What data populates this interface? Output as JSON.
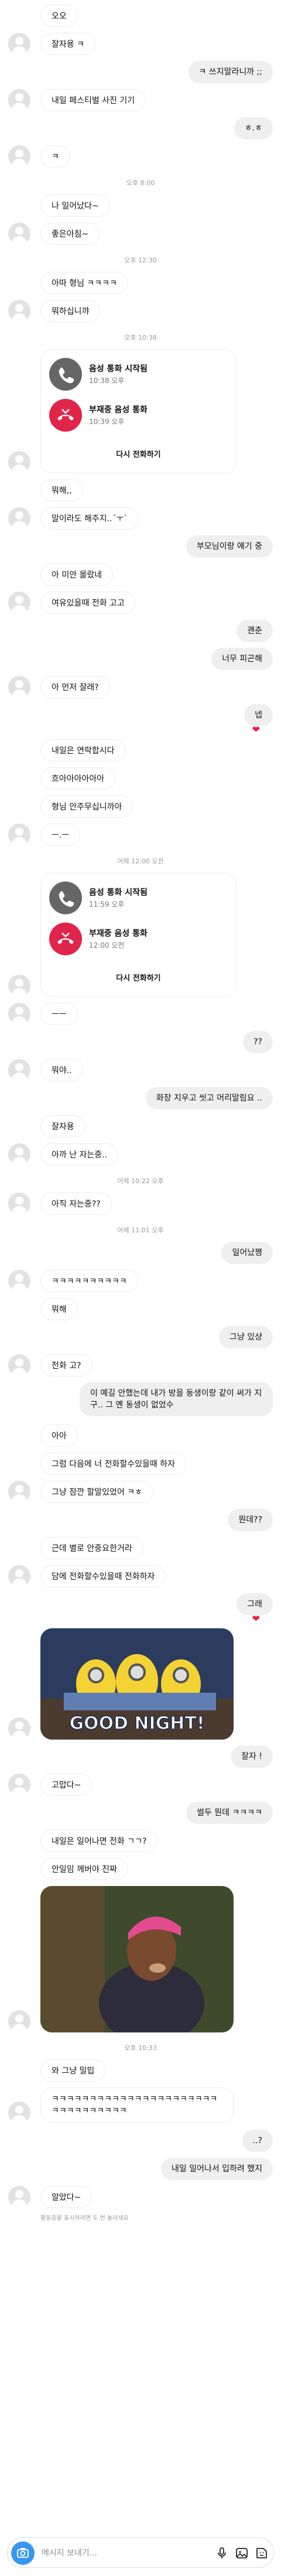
{
  "messages": [
    {
      "kind": "in",
      "text": "오오",
      "avatar": false
    },
    {
      "kind": "in",
      "text": "잘자용 ㅋ",
      "avatar": true
    },
    {
      "kind": "out",
      "text": "ㅋ 쓰지말라니까 ;;"
    },
    {
      "kind": "in",
      "text": "내일 페스티벌 사진 기기",
      "avatar": true
    },
    {
      "kind": "out",
      "text": "ㅎ.ㅎ"
    },
    {
      "kind": "in",
      "text": "ㅋ",
      "avatar": true
    },
    {
      "kind": "time",
      "text": "오후 8:00"
    },
    {
      "kind": "in",
      "text": "나 일어났다~",
      "avatar": false
    },
    {
      "kind": "in",
      "text": "좋은아침~",
      "avatar": true
    },
    {
      "kind": "time",
      "text": "오후 12:30"
    },
    {
      "kind": "in",
      "text": "아따 형님 ㅋㅋㅋㅋ",
      "avatar": false
    },
    {
      "kind": "in",
      "text": "뭐하십니꺄",
      "avatar": true
    },
    {
      "kind": "time",
      "text": "오후 10:38"
    }
  ],
  "call1": {
    "answered_title": "음성 통화 시작됨",
    "answered_time": "10:38 오후",
    "missed_title": "부재중 음성 통화",
    "missed_time": "10:39 오후",
    "callback": "다시 전화하기"
  },
  "messages2": [
    {
      "kind": "in",
      "text": "뭐해,,",
      "avatar": false
    },
    {
      "kind": "in",
      "text": "말이라도 해주지..´ㅜ`",
      "avatar": true
    },
    {
      "kind": "out",
      "text": "부모님이랑 얘기 중"
    },
    {
      "kind": "in",
      "text": "아 미안 몰랐네",
      "avatar": false
    },
    {
      "kind": "in",
      "text": "여유있을때 전화 고고",
      "avatar": true
    },
    {
      "kind": "out",
      "text": "괜춘"
    },
    {
      "kind": "out",
      "text": "너무 피곤해"
    },
    {
      "kind": "in",
      "text": "아 먼저 잘래?",
      "avatar": true
    },
    {
      "kind": "out",
      "text": "넵"
    },
    {
      "kind": "heart"
    },
    {
      "kind": "in",
      "text": "내일은 연락합시다",
      "avatar": false
    },
    {
      "kind": "in",
      "text": "흐아아아아아아",
      "avatar": false
    },
    {
      "kind": "in",
      "text": "형님 안주무십니까아",
      "avatar": false
    },
    {
      "kind": "in",
      "text": "ㅡ.ㅡ",
      "avatar": true
    }
  ],
  "call2": {
    "answered_title": "음성 통화 시작됨",
    "answered_time": "11:59 오후",
    "missed_title": "부재중 음성 통화",
    "missed_time": "12:00 오전",
    "callback": "다시 전화하기",
    "time_above": "어제 12:00 오전"
  },
  "messages3": [
    {
      "kind": "in",
      "text": "ㅡㅡ",
      "avatar": true
    },
    {
      "kind": "out",
      "text": "??"
    },
    {
      "kind": "in",
      "text": "뭐야..",
      "avatar": true
    },
    {
      "kind": "out",
      "text": "화장 지우고 씻고 머리말림요 .."
    },
    {
      "kind": "in",
      "text": "잘자용",
      "avatar": false
    },
    {
      "kind": "in",
      "text": "아까 난 자는중..",
      "avatar": true
    },
    {
      "kind": "time",
      "text": "어제 10:22 오후"
    },
    {
      "kind": "in",
      "text": "아직 자는중??",
      "avatar": true
    },
    {
      "kind": "time",
      "text": "어제 11:01 오후"
    },
    {
      "kind": "out",
      "text": "일어났쪙"
    },
    {
      "kind": "in",
      "text": "ㅋㅋㅋㅋㅋㅋㅋㅋㅋㅋ",
      "avatar": true
    },
    {
      "kind": "in",
      "text": "뭐해",
      "avatar": false
    },
    {
      "kind": "out",
      "text": "그냥 있샹"
    },
    {
      "kind": "in",
      "text": "전화 고?",
      "avatar": true
    },
    {
      "kind": "outmulti",
      "text": "이 예길 안했는데 내가 방을 동생이랑 같이 써가 지구.. 그 옌 동생이 없었수"
    },
    {
      "kind": "in",
      "text": "아아",
      "avatar": false
    },
    {
      "kind": "in",
      "text": "그럼 다음에 너 전화할수있을때 하자",
      "avatar": false
    },
    {
      "kind": "in",
      "text": "그냥 잠깐 할말있었어 ㅋㅎ",
      "avatar": true
    },
    {
      "kind": "out",
      "text": "뭔데??"
    },
    {
      "kind": "in",
      "text": "근데 별로 안중요한거라",
      "avatar": false
    },
    {
      "kind": "in",
      "text": "담에 전화할수있을때 전화하자",
      "avatar": true
    },
    {
      "kind": "out",
      "text": "그래"
    },
    {
      "kind": "heart"
    }
  ],
  "gif1": {
    "caption": "GOOD NIGHT!"
  },
  "messages4": [
    {
      "kind": "out",
      "text": "잘자 !"
    },
    {
      "kind": "in",
      "text": "고맙다~",
      "avatar": true
    },
    {
      "kind": "out",
      "text": "썰두 뭔데 ㅋㅋㅋㅋ"
    },
    {
      "kind": "in",
      "text": "내일은 일어나면 전화 ㄱㄱ?",
      "avatar": false
    },
    {
      "kind": "in",
      "text": "안일임 께버야 진짜",
      "avatar": false
    }
  ],
  "messages5": [
    {
      "kind": "time",
      "text": "오후 10:33"
    },
    {
      "kind": "in",
      "text": "와 그냥 밀밉",
      "avatar": false
    },
    {
      "kind": "inmulti",
      "text": "ㅋㅋㅋㅋㅋㅋㅋㅋㅋㅋㅋㅋㅋㅋㅋㅋㅋㅋㅋㅋㅋㅋㅋㅋㅋㅋㅋㅋㅋㅋㅋㅋ",
      "avatar": true
    },
    {
      "kind": "out",
      "text": "..?"
    },
    {
      "kind": "out",
      "text": "내일 일어나서 입하려 했지"
    },
    {
      "kind": "in",
      "text": "알았다~",
      "avatar": true
    }
  ],
  "seen_text": "활동중을 표시하려면 두 번 눌러세요",
  "composer": {
    "placeholder": "메시지 보내기..."
  },
  "colors": {
    "accent": "#3797f0",
    "missed": "#e0254a",
    "heart": "#ed1b40"
  }
}
